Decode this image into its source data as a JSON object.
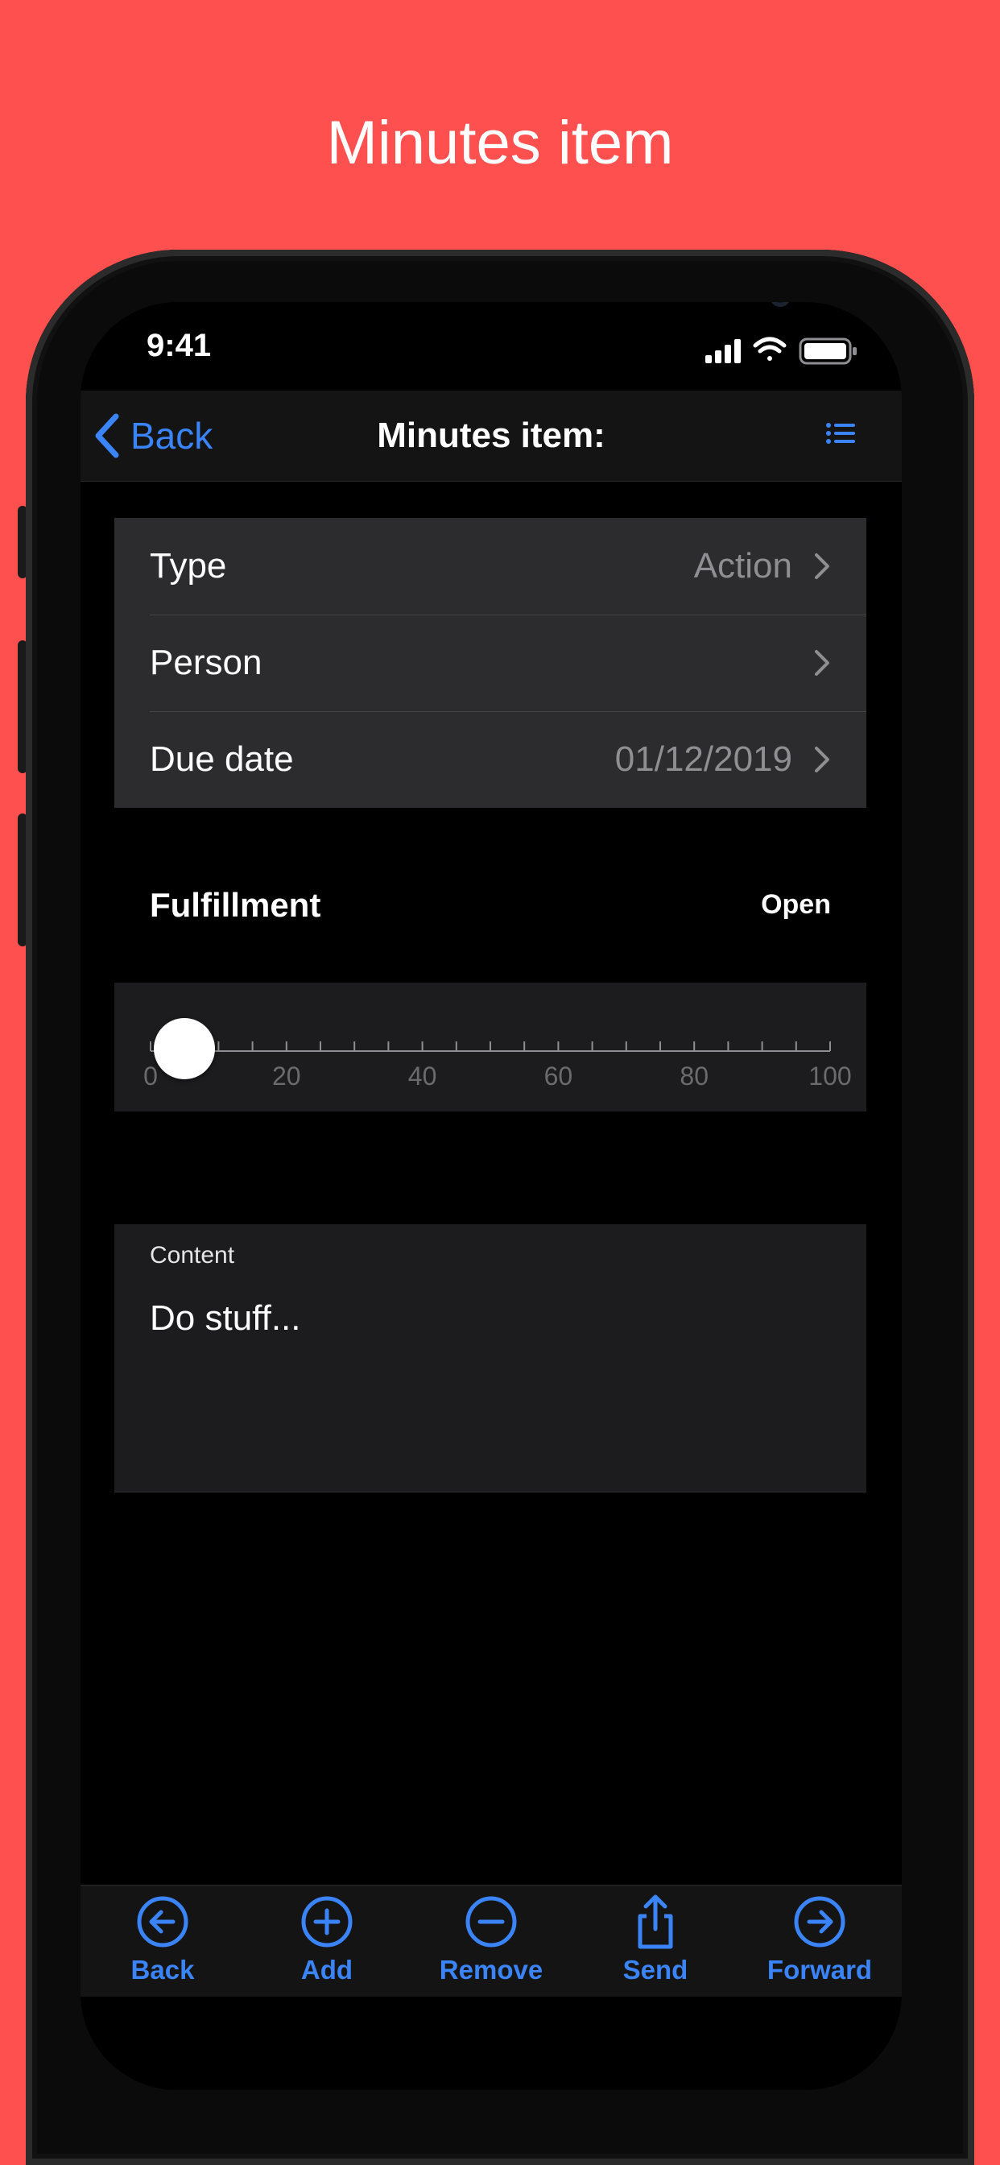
{
  "marketing_title": "Minutes item",
  "status_bar": {
    "time": "9:41"
  },
  "navbar": {
    "back_label": "Back",
    "title": "Minutes item:"
  },
  "rows": [
    {
      "label": "Type",
      "value": "Action"
    },
    {
      "label": "Person",
      "value": ""
    },
    {
      "label": "Due date",
      "value": "01/12/2019"
    }
  ],
  "fulfillment": {
    "label": "Fulfillment",
    "status": "Open",
    "slider_value": 5,
    "tick_labels": [
      "0",
      "20",
      "40",
      "60",
      "80",
      "100"
    ]
  },
  "content": {
    "label": "Content",
    "text": "Do stuff..."
  },
  "toolbar": {
    "items": [
      {
        "label": "Back",
        "icon": "arrow-left-circle-icon"
      },
      {
        "label": "Add",
        "icon": "plus-circle-icon"
      },
      {
        "label": "Remove",
        "icon": "minus-circle-icon"
      },
      {
        "label": "Send",
        "icon": "share-icon"
      },
      {
        "label": "Forward",
        "icon": "arrow-right-circle-icon"
      }
    ]
  },
  "colors": {
    "background": "#ff5050",
    "accent": "#3a84f7"
  }
}
